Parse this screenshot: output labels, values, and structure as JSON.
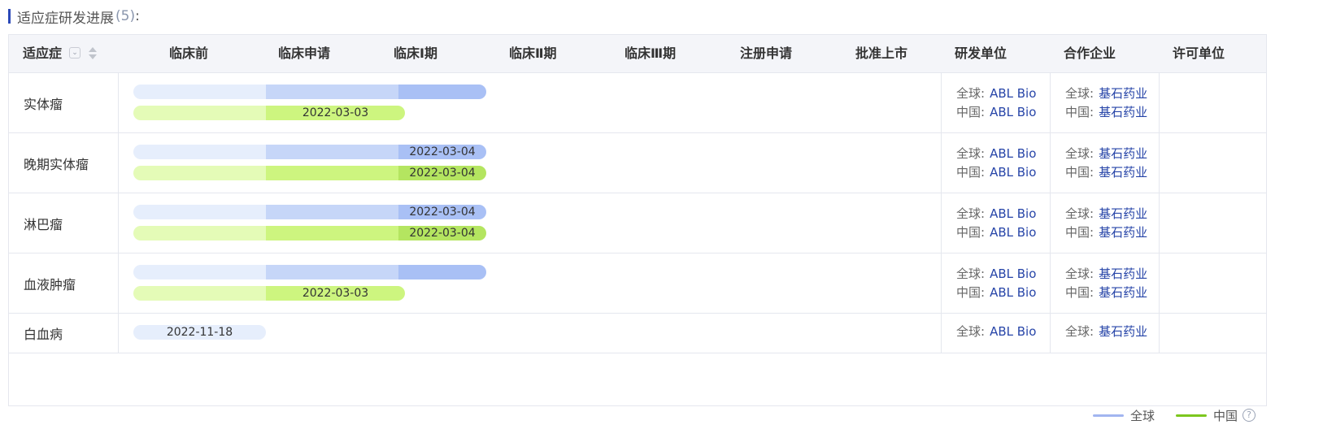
{
  "title": {
    "text": "适应症研发进展",
    "count": "(5)",
    "colon": ":"
  },
  "columns": [
    "适应症",
    "临床前",
    "临床申请",
    "临床Ⅰ期",
    "临床Ⅱ期",
    "临床Ⅲ期",
    "注册申请",
    "批准上市",
    "研发单位",
    "合作企业",
    "许可单位"
  ],
  "sort_icons": {
    "filter": "chevron-down-icon",
    "sort": "sort-arrows-icon"
  },
  "colors": {
    "global_light": "#e6eefc",
    "global_mid": "#c6d6f8",
    "global_strong": "#a9c0f5",
    "china_light": "#e4fbb7",
    "china_mid": "#cdf57f",
    "china_strong": "#b4e560",
    "legend_global": "#a2b5f0",
    "legend_china": "#7cc71e",
    "link": "#2745a8"
  },
  "party_labels": {
    "global": "全球:",
    "china": "中国:"
  },
  "rows": [
    {
      "indication": "实体瘤",
      "global": {
        "stage": 3,
        "date": ""
      },
      "china": {
        "stage": 2,
        "date": "2022-03-03"
      },
      "rd": {
        "global": "ABL Bio",
        "china": "ABL Bio"
      },
      "partner": {
        "global": "基石药业",
        "china": "基石药业"
      },
      "licensor": ""
    },
    {
      "indication": "晚期实体瘤",
      "global": {
        "stage": 3,
        "date": "2022-03-04"
      },
      "china": {
        "stage": 3,
        "date": "2022-03-04"
      },
      "rd": {
        "global": "ABL Bio",
        "china": "ABL Bio"
      },
      "partner": {
        "global": "基石药业",
        "china": "基石药业"
      },
      "licensor": ""
    },
    {
      "indication": "淋巴瘤",
      "global": {
        "stage": 3,
        "date": "2022-03-04"
      },
      "china": {
        "stage": 3,
        "date": "2022-03-04"
      },
      "rd": {
        "global": "ABL Bio",
        "china": "ABL Bio"
      },
      "partner": {
        "global": "基石药业",
        "china": "基石药业"
      },
      "licensor": ""
    },
    {
      "indication": "血液肿瘤",
      "global": {
        "stage": 3,
        "date": ""
      },
      "china": {
        "stage": 2,
        "date": "2022-03-03"
      },
      "rd": {
        "global": "ABL Bio",
        "china": "ABL Bio"
      },
      "partner": {
        "global": "基石药业",
        "china": "基石药业"
      },
      "licensor": ""
    },
    {
      "indication": "白血病",
      "global": {
        "stage": 1,
        "date": "2022-11-18"
      },
      "china": null,
      "rd": {
        "global": "ABL Bio",
        "china": null
      },
      "partner": {
        "global": "基石药业",
        "china": null
      },
      "licensor": ""
    }
  ],
  "legend": {
    "global": "全球",
    "china": "中国",
    "help_icon": "question-circle-icon"
  }
}
